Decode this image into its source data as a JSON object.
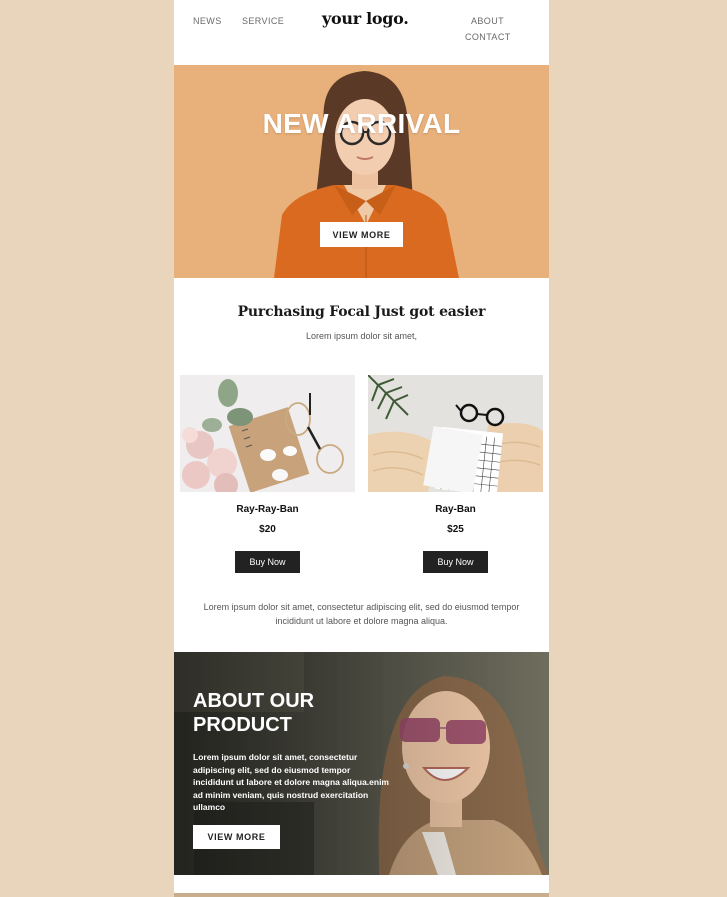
{
  "header": {
    "nav_left": [
      "NEWS",
      "SERVICE"
    ],
    "logo": "your logo.",
    "nav_right": [
      "ABOUT",
      "CONTACT"
    ]
  },
  "hero": {
    "title": "NEW ARRIVAL",
    "button": "VIEW MORE",
    "background_color": "#e8b07a",
    "shirt_color": "#d96a1f"
  },
  "intro": {
    "title": "Purchasing Focal Just got easier",
    "subtitle": "Lorem ipsum dolor sit amet,"
  },
  "products": [
    {
      "name": "Ray-Ray-Ban",
      "price": "$20",
      "button": "Buy Now"
    },
    {
      "name": "Ray-Ban",
      "price": "$25",
      "button": "Buy Now"
    }
  ],
  "description": "Lorem ipsum dolor sit amet, consectetur adipiscing elit, sed do eiusmod tempor incididunt ut labore et dolore magna aliqua.",
  "about": {
    "title": "ABOUT OUR PRODUCT",
    "body": "Lorem ipsum dolor sit amet, consectetur adipiscing elit, sed do eiusmod tempor incididunt ut labore et dolore magna aliqua.enim ad minim veniam, quis nostrud exercitation ullamco",
    "button": "VIEW MORE"
  },
  "colors": {
    "page_background": "#e8d5bb",
    "email_background": "#ffffff",
    "dark_button": "#222222",
    "text_dark": "#111111"
  }
}
